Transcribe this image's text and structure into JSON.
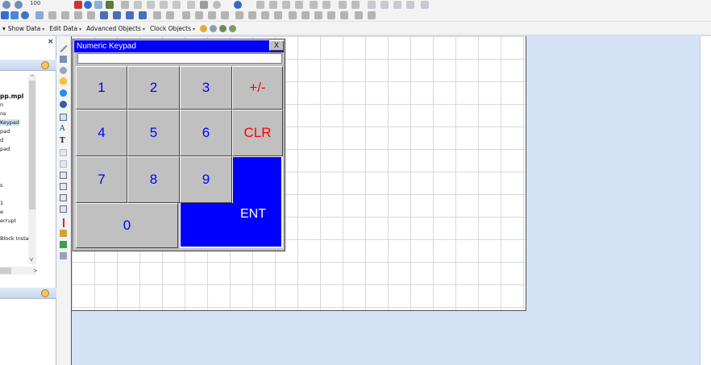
{
  "toolbar": {
    "zoom_value": "100"
  },
  "menubar": {
    "items": [
      {
        "label": "Show Data"
      },
      {
        "label": "Edit Data"
      },
      {
        "label": "Advanced Objects"
      },
      {
        "label": "Clock Objects"
      }
    ],
    "caret": "▾"
  },
  "left_panel": {
    "close_glyph": "×",
    "tree_items": [
      {
        "label": "pp.mpl"
      },
      {
        "label": "n"
      },
      {
        "label": "ns"
      },
      {
        "label": "Keypad"
      },
      {
        "label": "pad"
      },
      {
        "label": "d"
      },
      {
        "label": "pad"
      },
      {
        "label": "s"
      },
      {
        "label": "1"
      },
      {
        "label": "e"
      },
      {
        "label": "errupt"
      },
      {
        "label": "Block Insta"
      }
    ],
    "scroll_up": "^",
    "scroll_down": "v",
    "scroll_right": ">"
  },
  "keypad": {
    "title": "Numeric Keypad",
    "close_label": "X",
    "display_value": "",
    "keys": [
      {
        "label": "1"
      },
      {
        "label": "2"
      },
      {
        "label": "3"
      },
      {
        "label": "+/-"
      },
      {
        "label": "4"
      },
      {
        "label": "5"
      },
      {
        "label": "6"
      },
      {
        "label": "CLR"
      },
      {
        "label": "7"
      },
      {
        "label": "8"
      },
      {
        "label": "9"
      },
      {
        "label": "0"
      },
      {
        "label": "ENT"
      }
    ]
  },
  "colors": {
    "keypad_title_bg": "#0000ff",
    "digit_color": "#0000ff",
    "function_key_color": "#ff0000",
    "enter_key_bg": "#0000ff",
    "key_face": "#c0c0c0",
    "workspace_bg": "#d4e2f5"
  }
}
